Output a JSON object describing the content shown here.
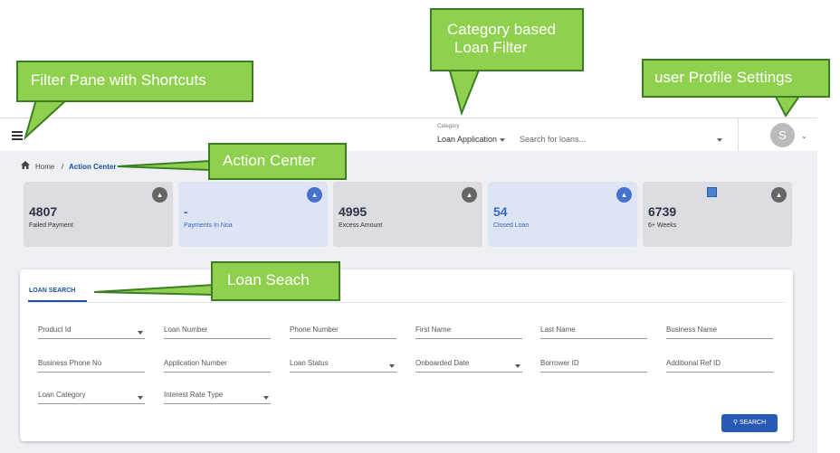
{
  "annotations": {
    "filter_pane": "Filter Pane with Shortcuts",
    "category_filter_line1": "Category based",
    "category_filter_line2": "Loan Filter",
    "user_profile": "user Profile Settings",
    "action_center": "Action Center",
    "loan_search": "Loan Seach"
  },
  "header": {
    "category_label": "Category",
    "category_value": "Loan Application",
    "search_placeholder": "Search for loans...",
    "avatar_initial": "S"
  },
  "breadcrumb": {
    "home": "Home",
    "separator": "/",
    "current": "Action Center"
  },
  "cards": [
    {
      "value": "4807",
      "label": "Failed Payment"
    },
    {
      "value": "-",
      "label": "Payments In Noa"
    },
    {
      "value": "4995",
      "label": "Excess Amount"
    },
    {
      "value": "54",
      "label": "Closed Loan"
    },
    {
      "value": "6739",
      "label": "6+ Weeks"
    }
  ],
  "loan_search": {
    "tab": "LOAN SEARCH",
    "fields": [
      "Product Id",
      "Loan Number",
      "Phone Number",
      "First Name",
      "Last Name",
      "Business Name",
      "Business Phone No",
      "Application Number",
      "Loan Status",
      "Onboarded Date",
      "Borrower ID",
      "Additional Ref ID",
      "Loan Category",
      "Interest Rate Type"
    ],
    "search_button": "SEARCH"
  },
  "colors": {
    "accent": "#1a4fa0",
    "callout_fill": "#8fd14f",
    "callout_border": "#3b7d23",
    "card_gray": "#dcdde0",
    "card_blue": "#dde4f4"
  }
}
